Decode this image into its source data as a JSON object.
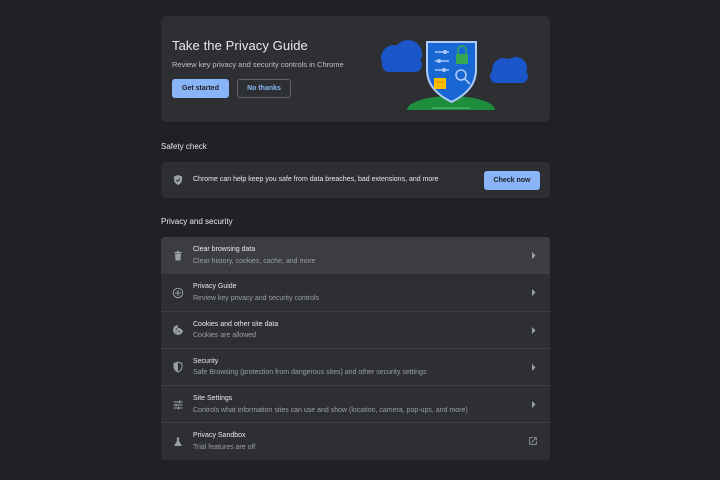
{
  "promo": {
    "title": "Take the Privacy Guide",
    "subtitle": "Review key privacy and security controls in Chrome",
    "get_started": "Get started",
    "no_thanks": "No thanks"
  },
  "safety_check": {
    "heading": "Safety check",
    "text": "Chrome can help keep you safe from data breaches, bad extensions, and more",
    "button": "Check now"
  },
  "privacy": {
    "heading": "Privacy and security",
    "items": [
      {
        "title": "Clear browsing data",
        "subtitle": "Clear history, cookies, cache, and more",
        "icon": "trash-icon",
        "trailing": "arrow"
      },
      {
        "title": "Privacy Guide",
        "subtitle": "Review key privacy and security controls",
        "icon": "privacy-guide-icon",
        "trailing": "arrow"
      },
      {
        "title": "Cookies and other site data",
        "subtitle": "Cookies are allowed",
        "icon": "cookie-icon",
        "trailing": "arrow"
      },
      {
        "title": "Security",
        "subtitle": "Safe Browsing (protection from dangerous sites) and other security settings",
        "icon": "shield-icon",
        "trailing": "arrow"
      },
      {
        "title": "Site Settings",
        "subtitle": "Controls what information sites can use and show (location, camera, pop-ups, and more)",
        "icon": "sliders-icon",
        "trailing": "arrow"
      },
      {
        "title": "Privacy Sandbox",
        "subtitle": "Trial features are off",
        "icon": "flask-icon",
        "trailing": "external-link"
      }
    ]
  },
  "colors": {
    "background": "#202124",
    "card": "#2e2f32",
    "accent": "#8ab4f8",
    "highlight_row": "#3c3d40"
  }
}
